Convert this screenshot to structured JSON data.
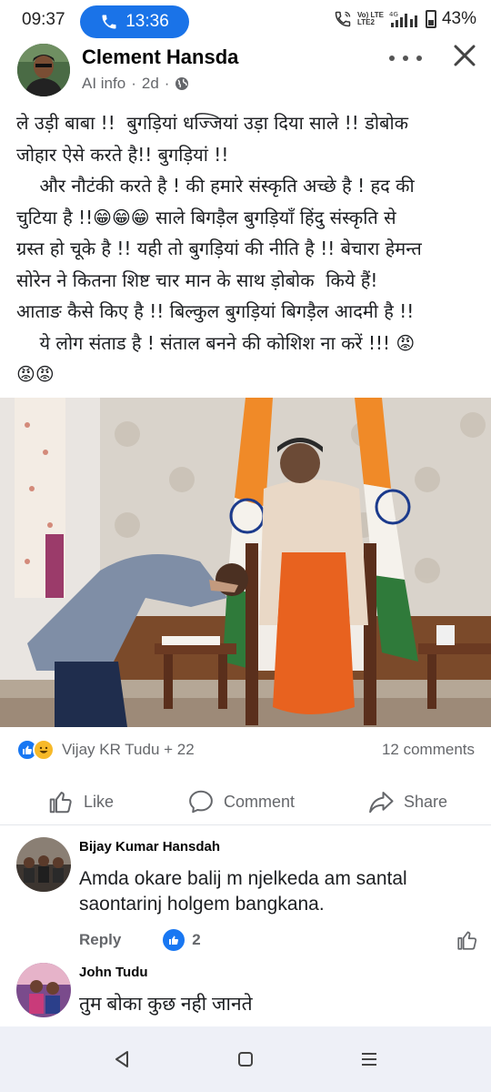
{
  "status_bar": {
    "time": "09:37",
    "call_timer": "13:36",
    "network_top": "Vo) LTE",
    "network_bottom": "LTE2",
    "network_type": "4G",
    "battery": "43%"
  },
  "post": {
    "author": "Clement Hansda",
    "meta_label": "AI info",
    "time_ago": "2d",
    "text_lines": [
      "ले उड़ी बाबा !!  बुगड़ियां धज्जियां उड़ा दिया साले !! डोबोक",
      "जोहार ऐसे करते है!! बुगड़ियां !!",
      "    और नौटंकी करते है ! की हमारे संस्कृति अच्छे है ! हद की",
      "चुटिया है !!😁😁😁 साले बिगड़ैल बुगड़ियाँ हिंदु संस्कृति से",
      "ग्रस्त हो चूके है !! यही तो बुगड़ियां की नीति है !! बेचारा हेमन्त",
      "सोरेन ने कितना शिष्ट चार मान के साथ ड़ोबोक  किये हैं!",
      "आताङ कैसे किए है !! बिल्कुल बुगड़ियां बिगड़ैल आदमी है !!",
      "    ये लोग संताड है ! संताल बनने की कोशिश ना करें !!! 😡",
      "😡😡"
    ],
    "reactions_names": "Vijay KR Tudu + 22",
    "comments_count": "12 comments"
  },
  "actions": {
    "like": "Like",
    "comment": "Comment",
    "share": "Share"
  },
  "comments": [
    {
      "name": "Bijay Kumar Hansdah",
      "text": "Amda okare balij m njelkeda am santal saontarinj holgem bangkana.",
      "reply_label": "Reply",
      "reaction_count": "2"
    },
    {
      "name": "John Tudu",
      "text": "तुम बोका कुछ नही जानते"
    }
  ],
  "colors": {
    "facebook_blue": "#1877f2",
    "call_pill": "#1a73e8",
    "secondary_text": "#65676b"
  }
}
